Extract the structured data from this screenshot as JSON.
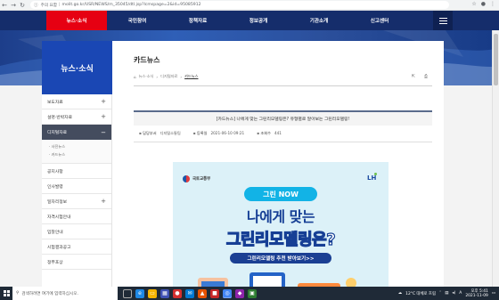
{
  "browser": {
    "security_label": "주의 요함",
    "url": "molit.go.kr/USR/NEWS/m_35045/dtl.jsp?lcmspage=2&id=95085912",
    "back_icon": "back-arrow-icon",
    "forward_icon": "forward-arrow-icon",
    "reload_icon": "reload-icon"
  },
  "gnb": {
    "items": [
      "뉴스·소식",
      "국민참여",
      "정책자료",
      "정보공개",
      "기관소개",
      "신고센터"
    ],
    "active_index": 0
  },
  "sidebar": {
    "title": "뉴스·소식",
    "items": [
      {
        "label": "보도자료",
        "expand": "+"
      },
      {
        "label": "설명·반박자료",
        "expand": "+"
      },
      {
        "label": "디지털자료",
        "expand": "−"
      },
      {
        "label": "공지사항",
        "expand": ""
      },
      {
        "label": "인사발령",
        "expand": ""
      },
      {
        "label": "일자리정보",
        "expand": "+"
      },
      {
        "label": "자격시험안내",
        "expand": ""
      },
      {
        "label": "입찰안내",
        "expand": ""
      },
      {
        "label": "시험결과공고",
        "expand": ""
      },
      {
        "label": "정부포상",
        "expand": ""
      }
    ],
    "sub_items": [
      "사진뉴스",
      "카드뉴스"
    ]
  },
  "content": {
    "page_title": "카드뉴스",
    "breadcrumb": [
      "뉴스·소식",
      "디지털자료",
      "카드뉴스"
    ],
    "article_title": "[카드뉴스] 나에게 맞는 그린리모델링은? 유형별로 알아보는 그린리모델링!",
    "meta": {
      "dept_label": "담당부서",
      "dept_value": "디지털소통팀",
      "date_label": "등록일",
      "date_value": "2021-06-10 09:21",
      "views_label": "조회수",
      "views_value": "441"
    }
  },
  "card": {
    "ministry": "국토교통부",
    "partner": "LH",
    "badge": "그린 NOW",
    "line1": "나에게 맞는",
    "line2": "그린리모델링은?",
    "cta": "그린리모델링 추천 받아보기>>"
  },
  "taskbar": {
    "search_placeholder": "검색하려면 여기에 입력하십시오.",
    "weather": "12°C 대체로 흐림",
    "time": "오후 5:41",
    "date": "2021-11-09",
    "lang": "A"
  },
  "colors": {
    "header": "#152d6b",
    "active_tab": "#e60012",
    "sidebar_title": "#1a47b4",
    "card_bg": "#dcf1f8",
    "card_text": "#163f95"
  }
}
